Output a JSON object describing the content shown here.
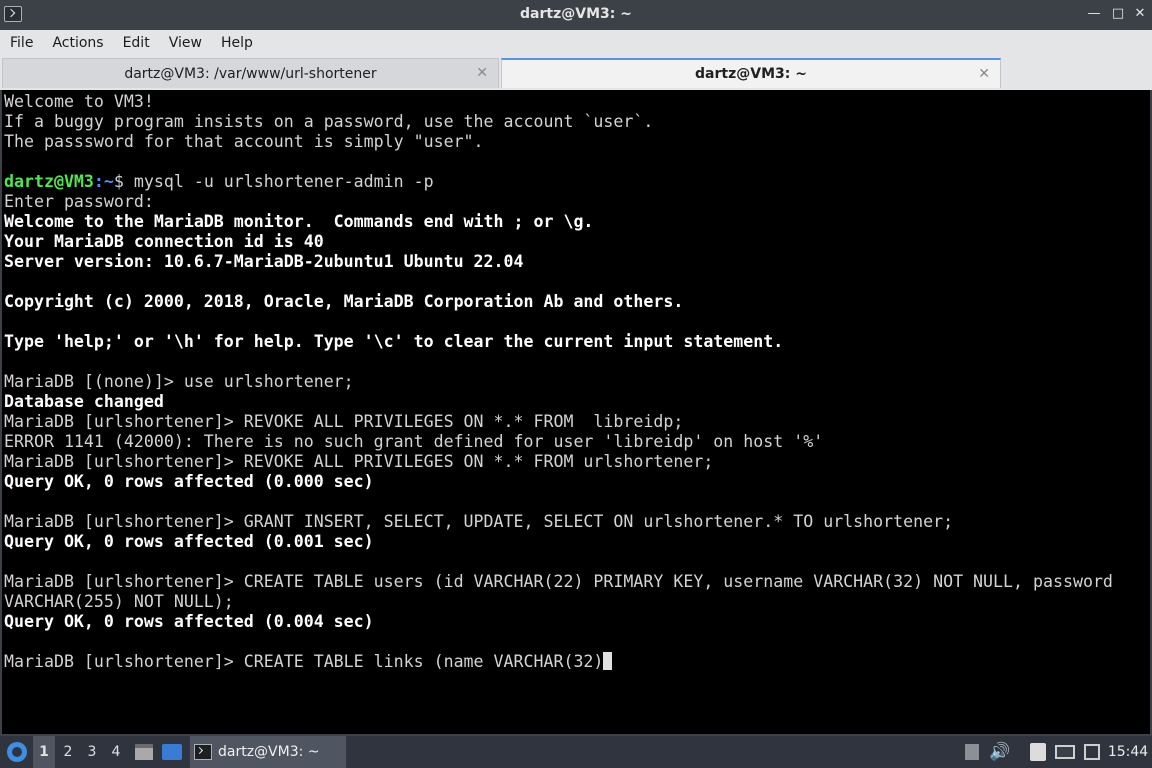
{
  "window": {
    "title": "dartz@VM3: ~",
    "min_glyph": "—",
    "max_glyph": "□",
    "close_glyph": "✕"
  },
  "menu": [
    "File",
    "Actions",
    "Edit",
    "View",
    "Help"
  ],
  "tabs": [
    {
      "label": "dartz@VM3: /var/www/url-shortener",
      "close": "✕"
    },
    {
      "label": "dartz@VM3: ~",
      "close": "✕"
    }
  ],
  "terminal": {
    "welcome": [
      "Welcome to VM3!",
      "If a buggy program insists on a password, use the account `user`.",
      "The passsword for that account is simply \"user\"."
    ],
    "shell_prompt_user": "dartz@VM3",
    "shell_prompt_path": ":~",
    "shell_prompt_end": "$ ",
    "shell_command": "mysql -u urlshortener-admin -p",
    "enter_password": "Enter password:",
    "banner": [
      "Welcome to the MariaDB monitor.  Commands end with ; or \\g.",
      "Your MariaDB connection id is 40",
      "Server version: 10.6.7-MariaDB-2ubuntu1 Ubuntu 22.04"
    ],
    "copyright": "Copyright (c) 2000, 2018, Oracle, MariaDB Corporation Ab and others.",
    "help_hint": "Type 'help;' or '\\h' for help. Type '\\c' to clear the current input statement.",
    "session": [
      {
        "text": "MariaDB [(none)]> use urlshortener;",
        "bold": false
      },
      {
        "text": "Database changed",
        "bold": true
      },
      {
        "text": "MariaDB [urlshortener]> REVOKE ALL PRIVILEGES ON *.* FROM  libreidp;",
        "bold": false
      },
      {
        "text": "ERROR 1141 (42000): There is no such grant defined for user 'libreidp' on host '%'",
        "bold": false
      },
      {
        "text": "MariaDB [urlshortener]> REVOKE ALL PRIVILEGES ON *.* FROM urlshortener;",
        "bold": false
      },
      {
        "text": "Query OK, 0 rows affected (0.000 sec)",
        "bold": true
      },
      {
        "text": "",
        "bold": false
      },
      {
        "text": "MariaDB [urlshortener]> GRANT INSERT, SELECT, UPDATE, SELECT ON urlshortener.* TO urlshortener;",
        "bold": false
      },
      {
        "text": "Query OK, 0 rows affected (0.001 sec)",
        "bold": true
      },
      {
        "text": "",
        "bold": false
      },
      {
        "text": "MariaDB [urlshortener]> CREATE TABLE users (id VARCHAR(22) PRIMARY KEY, username VARCHAR(32) NOT NULL, password",
        "bold": false
      },
      {
        "text": "VARCHAR(255) NOT NULL);",
        "bold": false
      },
      {
        "text": "Query OK, 0 rows affected (0.004 sec)",
        "bold": true
      },
      {
        "text": "",
        "bold": false
      }
    ],
    "current_input": "MariaDB [urlshortener]> CREATE TABLE links (name VARCHAR(32)"
  },
  "taskbar": {
    "workspaces": [
      "1",
      "2",
      "3",
      "4"
    ],
    "active_workspace": "1",
    "task_label": "dartz@VM3: ~",
    "volume_glyph": "🔊",
    "clock": "15:44"
  }
}
